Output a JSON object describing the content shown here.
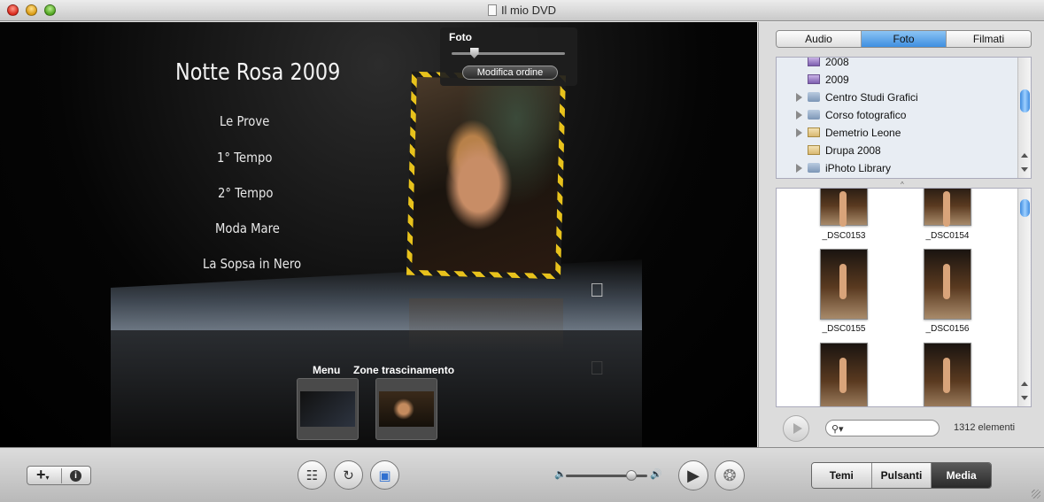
{
  "window": {
    "title": "Il mio DVD"
  },
  "stage": {
    "menu_title": "Notte Rosa 2009",
    "menu_items": [
      "Le Prove",
      "1° Tempo",
      "2° Tempo",
      "Moda Mare",
      "La Sopsa in Nero"
    ],
    "hud": {
      "title": "Foto",
      "button": "Modifica ordine",
      "slider_level": 0.2
    },
    "zones": {
      "menu_label": "Menu",
      "drop_label": "Zone trascinamento"
    }
  },
  "panel": {
    "tabs": [
      "Audio",
      "Foto",
      "Filmati"
    ],
    "selected_tab": "Foto",
    "tree": [
      {
        "label": "2008",
        "icon": "event-icon",
        "expandable": false
      },
      {
        "label": "2009",
        "icon": "event-icon",
        "expandable": false
      },
      {
        "label": "Centro Studi Grafici",
        "icon": "folder-icon",
        "expandable": true
      },
      {
        "label": "Corso fotografico",
        "icon": "folder-icon",
        "expandable": true
      },
      {
        "label": "Demetrio Leone",
        "icon": "album-icon",
        "expandable": true
      },
      {
        "label": "Drupa 2008",
        "icon": "album-icon",
        "expandable": false
      },
      {
        "label": "iPhoto Library",
        "icon": "folder-icon",
        "expandable": true
      }
    ],
    "photos": [
      "_DSC0153",
      "_DSC0154",
      "_DSC0155",
      "_DSC0156",
      "",
      ""
    ],
    "search": {
      "placeholder": ""
    },
    "count": "1312 elementi"
  },
  "toolbar": {
    "view_tabs": [
      "Temi",
      "Pulsanti",
      "Media"
    ],
    "selected_view": "Media",
    "volume_level": 0.8
  },
  "colors": {
    "selection_blue": "#3f8fe0",
    "hud_bg": "#1e1e1e",
    "frame_yellow": "#e8c21c"
  }
}
